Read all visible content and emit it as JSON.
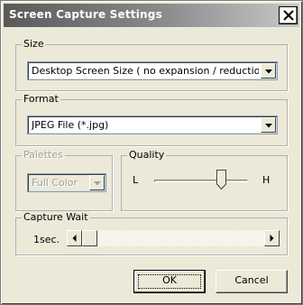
{
  "window": {
    "title": "Screen Capture Settings"
  },
  "size_group": {
    "label": "Size",
    "selected": "Desktop Screen Size ( no expansion / reduction )"
  },
  "format_group": {
    "label": "Format",
    "selected": "JPEG File (*.jpg)"
  },
  "palettes_group": {
    "label": "Palettes",
    "selected": "Full Color",
    "enabled": false
  },
  "quality_group": {
    "label": "Quality",
    "low_label": "L",
    "high_label": "H",
    "slider_position": 0.75
  },
  "capture_wait_group": {
    "label": "Capture Wait",
    "value_text": "1sec.",
    "scroll_position": 0
  },
  "buttons": {
    "ok": "OK",
    "cancel": "Cancel"
  }
}
